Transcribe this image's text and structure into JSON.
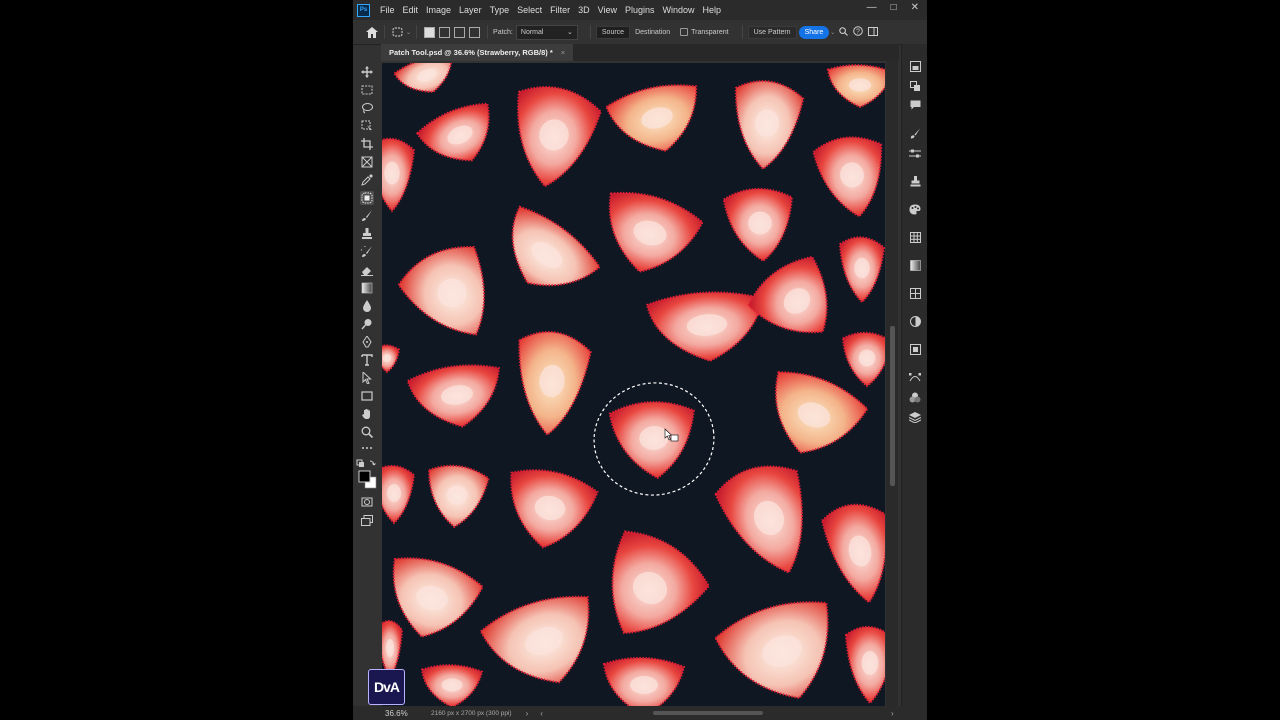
{
  "menubar": {
    "app_logo": "Ps",
    "items": [
      "File",
      "Edit",
      "Image",
      "Layer",
      "Type",
      "Select",
      "Filter",
      "3D",
      "View",
      "Plugins",
      "Window",
      "Help"
    ],
    "window_controls": [
      "—",
      "□",
      "✕"
    ]
  },
  "options": {
    "patch_label": "Patch:",
    "patch_value": "Normal",
    "source_label": "Source",
    "destination_label": "Destination",
    "transparent_label": "Transparent",
    "use_pattern_label": "Use Pattern",
    "share_label": "Share"
  },
  "document": {
    "tab_title": "Patch Tool.psd @ 36.6% (Strawberry, RGB/8) *",
    "close_glyph": "×"
  },
  "status": {
    "zoom": "36.6%",
    "info": "2160 px x 2700 px (300 ppi)"
  },
  "watermark": {
    "text": "DvA"
  },
  "colors": {
    "background_canvas": "#0f1722",
    "strawberry_red": "#e0283a",
    "strawberry_flesh": "#f6c8c0",
    "accent_blue": "#1473e6"
  }
}
